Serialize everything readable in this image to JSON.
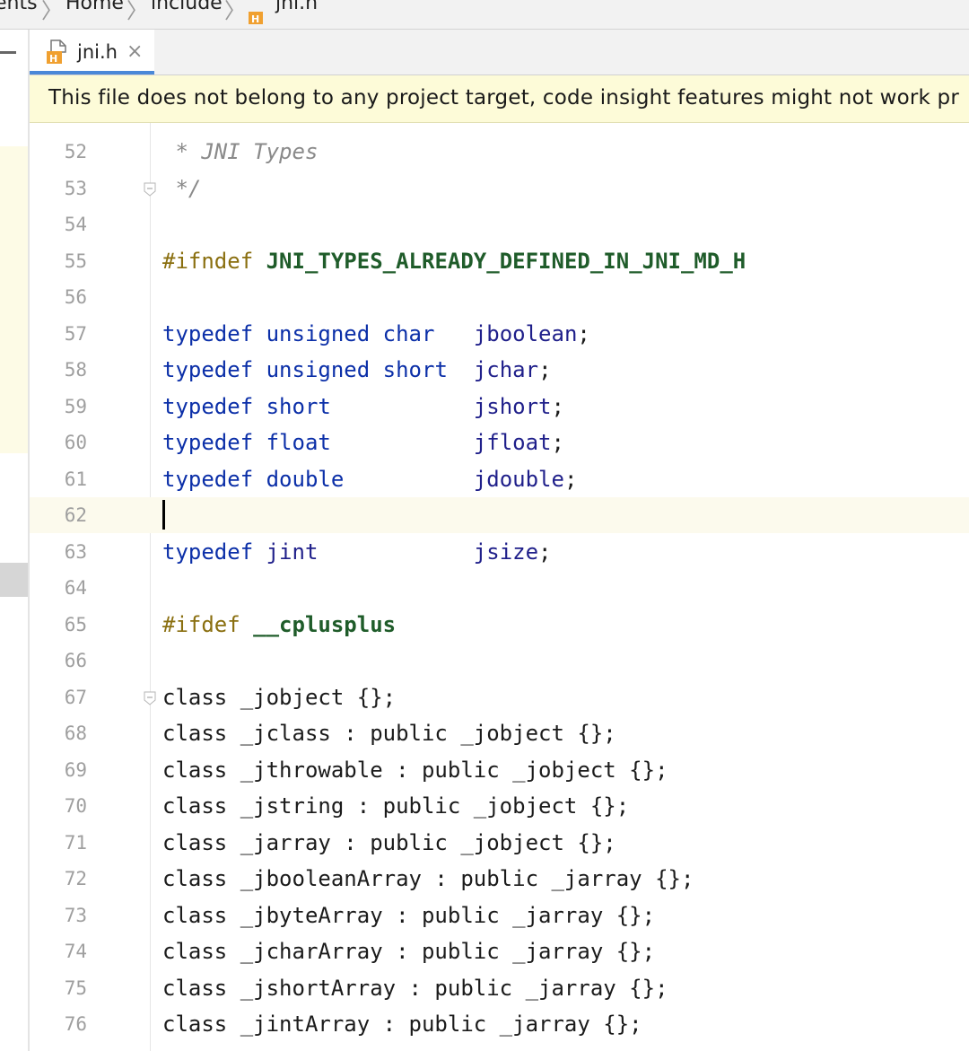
{
  "breadcrumb": {
    "items": [
      "ents",
      "Home",
      "include",
      "jni.h"
    ]
  },
  "tab": {
    "label": "jni.h",
    "close": "×"
  },
  "banner": {
    "text": "This file does not belong to any project target, code insight features might not work pr"
  },
  "editor": {
    "current_line": 62,
    "lines": [
      {
        "n": "52",
        "tokens": [
          {
            "t": " * JNI Types",
            "c": "cm"
          }
        ]
      },
      {
        "n": "53",
        "tokens": [
          {
            "t": " */",
            "c": "cm"
          }
        ],
        "fold": true
      },
      {
        "n": "54",
        "tokens": []
      },
      {
        "n": "55",
        "tokens": [
          {
            "t": "#ifndef",
            "c": "pp"
          },
          {
            "t": " "
          },
          {
            "t": "JNI_TYPES_ALREADY_DEFINED_IN_JNI_MD_H",
            "c": "macro"
          }
        ]
      },
      {
        "n": "56",
        "tokens": []
      },
      {
        "n": "57",
        "tokens": [
          {
            "t": "typedef",
            "c": "kw"
          },
          {
            "t": " "
          },
          {
            "t": "unsigned",
            "c": "kw"
          },
          {
            "t": " "
          },
          {
            "t": "char",
            "c": "kw"
          },
          {
            "t": "   "
          },
          {
            "t": "jboolean",
            "c": "id"
          },
          {
            "t": ";"
          }
        ]
      },
      {
        "n": "58",
        "tokens": [
          {
            "t": "typedef",
            "c": "kw"
          },
          {
            "t": " "
          },
          {
            "t": "unsigned",
            "c": "kw"
          },
          {
            "t": " "
          },
          {
            "t": "short",
            "c": "kw"
          },
          {
            "t": "  "
          },
          {
            "t": "jchar",
            "c": "id"
          },
          {
            "t": ";"
          }
        ]
      },
      {
        "n": "59",
        "tokens": [
          {
            "t": "typedef",
            "c": "kw"
          },
          {
            "t": " "
          },
          {
            "t": "short",
            "c": "kw"
          },
          {
            "t": "           "
          },
          {
            "t": "jshort",
            "c": "id"
          },
          {
            "t": ";"
          }
        ]
      },
      {
        "n": "60",
        "tokens": [
          {
            "t": "typedef",
            "c": "kw"
          },
          {
            "t": " "
          },
          {
            "t": "float",
            "c": "kw"
          },
          {
            "t": "           "
          },
          {
            "t": "jfloat",
            "c": "id"
          },
          {
            "t": ";"
          }
        ]
      },
      {
        "n": "61",
        "tokens": [
          {
            "t": "typedef",
            "c": "kw"
          },
          {
            "t": " "
          },
          {
            "t": "double",
            "c": "kw"
          },
          {
            "t": "          "
          },
          {
            "t": "jdouble",
            "c": "id"
          },
          {
            "t": ";"
          }
        ]
      },
      {
        "n": "62",
        "tokens": [],
        "current": true
      },
      {
        "n": "63",
        "tokens": [
          {
            "t": "typedef",
            "c": "kw"
          },
          {
            "t": " "
          },
          {
            "t": "jint",
            "c": "id"
          },
          {
            "t": "            "
          },
          {
            "t": "jsize",
            "c": "id"
          },
          {
            "t": ";"
          }
        ]
      },
      {
        "n": "64",
        "tokens": []
      },
      {
        "n": "65",
        "tokens": [
          {
            "t": "#ifdef",
            "c": "pp"
          },
          {
            "t": " "
          },
          {
            "t": "__cplusplus",
            "c": "macro"
          }
        ]
      },
      {
        "n": "66",
        "tokens": []
      },
      {
        "n": "67",
        "tokens": [
          {
            "t": "class _jobject {};"
          }
        ],
        "fold": true
      },
      {
        "n": "68",
        "tokens": [
          {
            "t": "class _jclass : public _jobject {};"
          }
        ]
      },
      {
        "n": "69",
        "tokens": [
          {
            "t": "class _jthrowable : public _jobject {};"
          }
        ]
      },
      {
        "n": "70",
        "tokens": [
          {
            "t": "class _jstring : public _jobject {};"
          }
        ]
      },
      {
        "n": "71",
        "tokens": [
          {
            "t": "class _jarray : public _jobject {};"
          }
        ]
      },
      {
        "n": "72",
        "tokens": [
          {
            "t": "class _jbooleanArray : public _jarray {};"
          }
        ]
      },
      {
        "n": "73",
        "tokens": [
          {
            "t": "class _jbyteArray : public _jarray {};"
          }
        ]
      },
      {
        "n": "74",
        "tokens": [
          {
            "t": "class _jcharArray : public _jarray {};"
          }
        ]
      },
      {
        "n": "75",
        "tokens": [
          {
            "t": "class _jshortArray : public _jarray {};"
          }
        ]
      },
      {
        "n": "76",
        "tokens": [
          {
            "t": "class _jintArray : public _jarray {};"
          }
        ]
      }
    ]
  },
  "colors": {
    "accent": "#4a88d8",
    "banner_bg": "#fdfbd8",
    "keyword": "#0b2fa8",
    "identifier": "#1f1f8a",
    "preprocessor": "#8a6f10",
    "macro": "#1f5c2a",
    "comment": "#8a8a8a"
  },
  "icons": {
    "file": "header-file-icon",
    "close": "close-icon",
    "fold": "fold-marker-icon"
  }
}
